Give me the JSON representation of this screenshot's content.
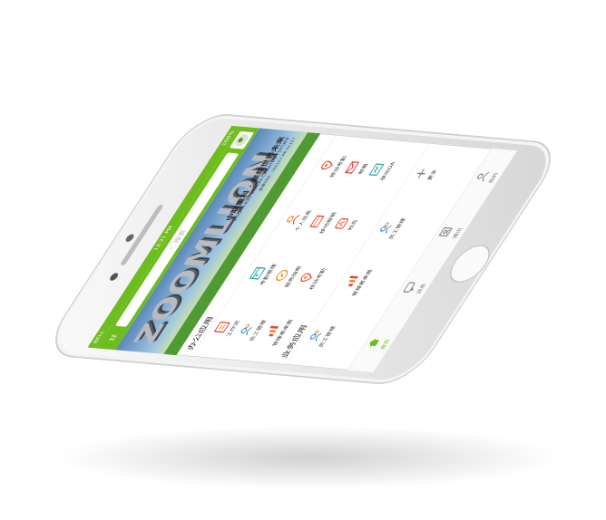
{
  "status": {
    "carrier": "BELL",
    "time": "12:21 PM",
    "battery": "100%"
  },
  "search": {
    "placeholder": "搜索"
  },
  "banner": {
    "logo": "ZOOMLION",
    "line1": "中联重科 · 联想世界未来",
    "line2": "ZOOMLION  VISION CREATES FUTURE",
    "line3": "股票代码：000157  HK 01157"
  },
  "sections": {
    "office": {
      "title": "办公应用",
      "apps": [
        {
          "label": "工作流",
          "icon": "report-icon"
        },
        {
          "label": "考勤管理",
          "icon": "calendar-icon"
        },
        {
          "label": "个人信息",
          "icon": "person-icon"
        },
        {
          "label": "移动考勤",
          "icon": "location-icon"
        },
        {
          "label": "员工管理",
          "icon": "staff-icon"
        },
        {
          "label": "服务指南",
          "icon": "compass-icon"
        },
        {
          "label": "移动报销",
          "icon": "reimburse-icon"
        },
        {
          "label": "邮箱",
          "icon": "mail-icon"
        },
        {
          "label": "管理者桌面",
          "icon": "chart-icon"
        },
        {
          "label": "移动考勤",
          "icon": "location-icon"
        },
        {
          "label": "知岛",
          "icon": "island-icon"
        },
        {
          "label": "移动OA",
          "icon": "oa-icon"
        }
      ]
    },
    "business": {
      "title": "业务应用",
      "apps": [
        {
          "label": "员工管理",
          "icon": "staff-icon"
        },
        {
          "label": "管理者桌面",
          "icon": "chart-icon"
        },
        {
          "label": "员工管理",
          "icon": "staff-icon"
        },
        {
          "label": "更多",
          "icon": "plus-icon"
        }
      ]
    }
  },
  "tabs": [
    {
      "label": "首页",
      "icon": "home-icon"
    },
    {
      "label": "消息",
      "icon": "message-icon"
    },
    {
      "label": "通讯",
      "icon": "contacts-icon"
    },
    {
      "label": "我的",
      "icon": "user-icon"
    }
  ],
  "colors": {
    "brand": "#6ebd1f",
    "orange": "#f08a24",
    "teal": "#2aa6a0",
    "red": "#e8453c",
    "blue": "#3a8fd6"
  }
}
